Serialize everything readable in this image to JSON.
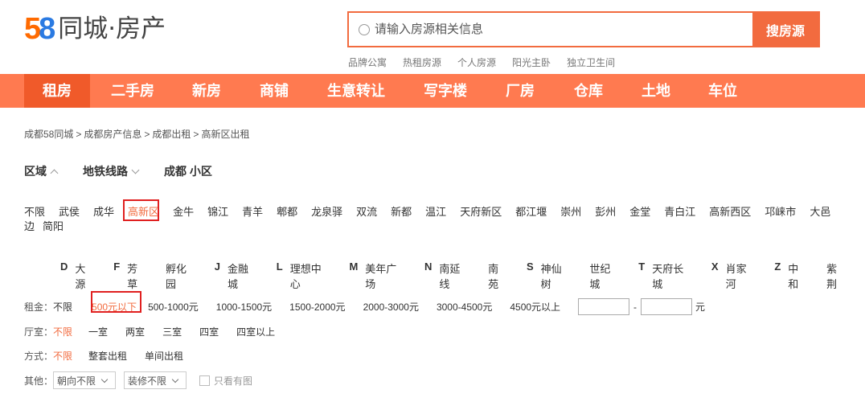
{
  "logo": {
    "text_5": "5",
    "text_8": "8",
    "brand": "同城·房产"
  },
  "search": {
    "placeholder": "请输入房源相关信息",
    "button": "搜房源"
  },
  "hotlinks": [
    "品牌公寓",
    "热租房源",
    "个人房源",
    "阳光主卧",
    "独立卫生间"
  ],
  "nav": [
    "租房",
    "二手房",
    "新房",
    "商铺",
    "生意转让",
    "写字楼",
    "厂房",
    "仓库",
    "土地",
    "车位"
  ],
  "breadcrumb": [
    "成都58同城",
    "成都房产信息",
    "成都出租",
    "高新区出租"
  ],
  "filter_tabs": [
    "区域",
    "地铁线路",
    "成都 小区"
  ],
  "districts": [
    "不限",
    "武侯",
    "成华",
    "高新区",
    "金牛",
    "锦江",
    "青羊",
    "郫都",
    "龙泉驿",
    "双流",
    "新都",
    "温江",
    "天府新区",
    "都江堰",
    "崇州",
    "彭州",
    "金堂",
    "青白江",
    "高新西区",
    "邛崃市",
    "大邑",
    "边",
    "简阳"
  ],
  "sub_areas": [
    {
      "letter": "D",
      "name": "大源"
    },
    {
      "letter": "F",
      "name": "芳草"
    },
    {
      "letter": "",
      "name": "孵化园"
    },
    {
      "letter": "J",
      "name": "金融城"
    },
    {
      "letter": "L",
      "name": "理想中心"
    },
    {
      "letter": "M",
      "name": "美年广场"
    },
    {
      "letter": "N",
      "name": "南延线"
    },
    {
      "letter": "",
      "name": "南苑"
    },
    {
      "letter": "S",
      "name": "神仙树"
    },
    {
      "letter": "",
      "name": "世纪城"
    },
    {
      "letter": "T",
      "name": "天府长城"
    },
    {
      "letter": "X",
      "name": "肖家河"
    },
    {
      "letter": "Z",
      "name": "中和"
    },
    {
      "letter": "",
      "name": "紫荆"
    }
  ],
  "rent": {
    "label": "租金：",
    "options": [
      "不限",
      "500元以下",
      "500-1000元",
      "1000-1500元",
      "1500-2000元",
      "2000-3000元",
      "3000-4500元",
      "4500元以上"
    ],
    "dash": "-",
    "unit": "元"
  },
  "rooms": {
    "label": "厅室：",
    "options": [
      "不限",
      "一室",
      "两室",
      "三室",
      "四室",
      "四室以上"
    ]
  },
  "mode": {
    "label": "方式：",
    "options": [
      "不限",
      "整套出租",
      "单间出租"
    ]
  },
  "other": {
    "label": "其他：",
    "orientation": "朝向不限",
    "decoration": "装修不限",
    "photo_only": "只看有图"
  },
  "colors": {
    "accent": "#f26b3f",
    "nav_bg": "#ff7a50",
    "nav_active": "#f05a2a",
    "highlight_box": "#e02020"
  }
}
